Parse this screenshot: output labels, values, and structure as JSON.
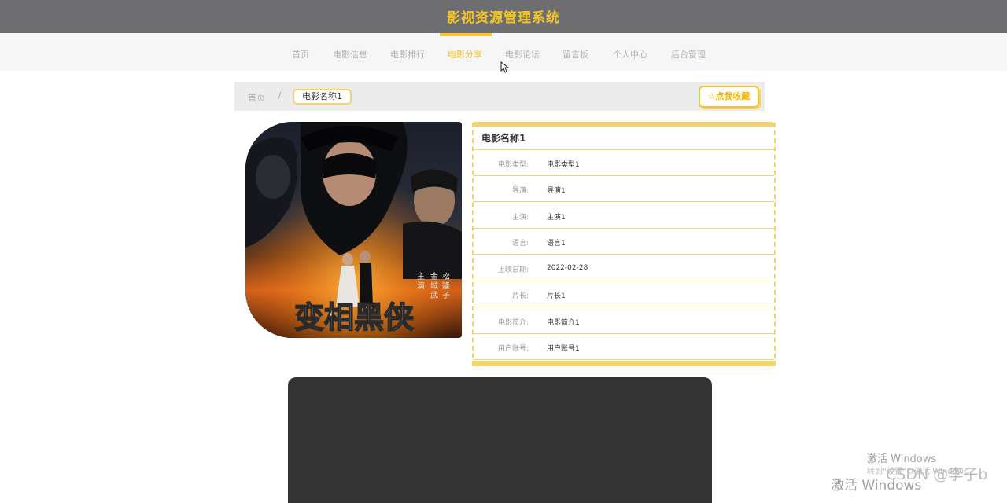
{
  "app": {
    "title": "影视资源管理系统"
  },
  "nav": {
    "items": [
      "首页",
      "电影信息",
      "电影排行",
      "电影分享",
      "电影论坛",
      "留言板",
      "个人中心",
      "后台管理"
    ],
    "active": "电影分享"
  },
  "breadcrumb": {
    "home": "首页",
    "separator": "/",
    "current": "电影名称1"
  },
  "favorite_button": {
    "icon": "star-icon",
    "label": "☆点我收藏"
  },
  "poster": {
    "title_art": "变相黑侠",
    "cast_text": "松隆子 金城武 主演"
  },
  "detail": {
    "title": "电影名称1",
    "rows": [
      {
        "label": "电影类型:",
        "value": "电影类型1"
      },
      {
        "label": "导演:",
        "value": "导演1"
      },
      {
        "label": "主演:",
        "value": "主演1"
      },
      {
        "label": "语言:",
        "value": "语言1"
      },
      {
        "label": "上映日期:",
        "value": "2022-02-28"
      },
      {
        "label": "片长:",
        "value": "片长1"
      },
      {
        "label": "电影简介:",
        "value": "电影简介1"
      },
      {
        "label": "用户账号:",
        "value": "用户账号1"
      }
    ]
  },
  "watermark": {
    "activate_title": "激活 Windows",
    "activate_hint": "转到“设置”以激活 Windows。",
    "csdn": "CSDN @李子b",
    "activate_large": "激活 Windows"
  },
  "colors": {
    "accent": "#f5c52a",
    "topbar": "#6e6e70",
    "video_bg": "#333333"
  }
}
